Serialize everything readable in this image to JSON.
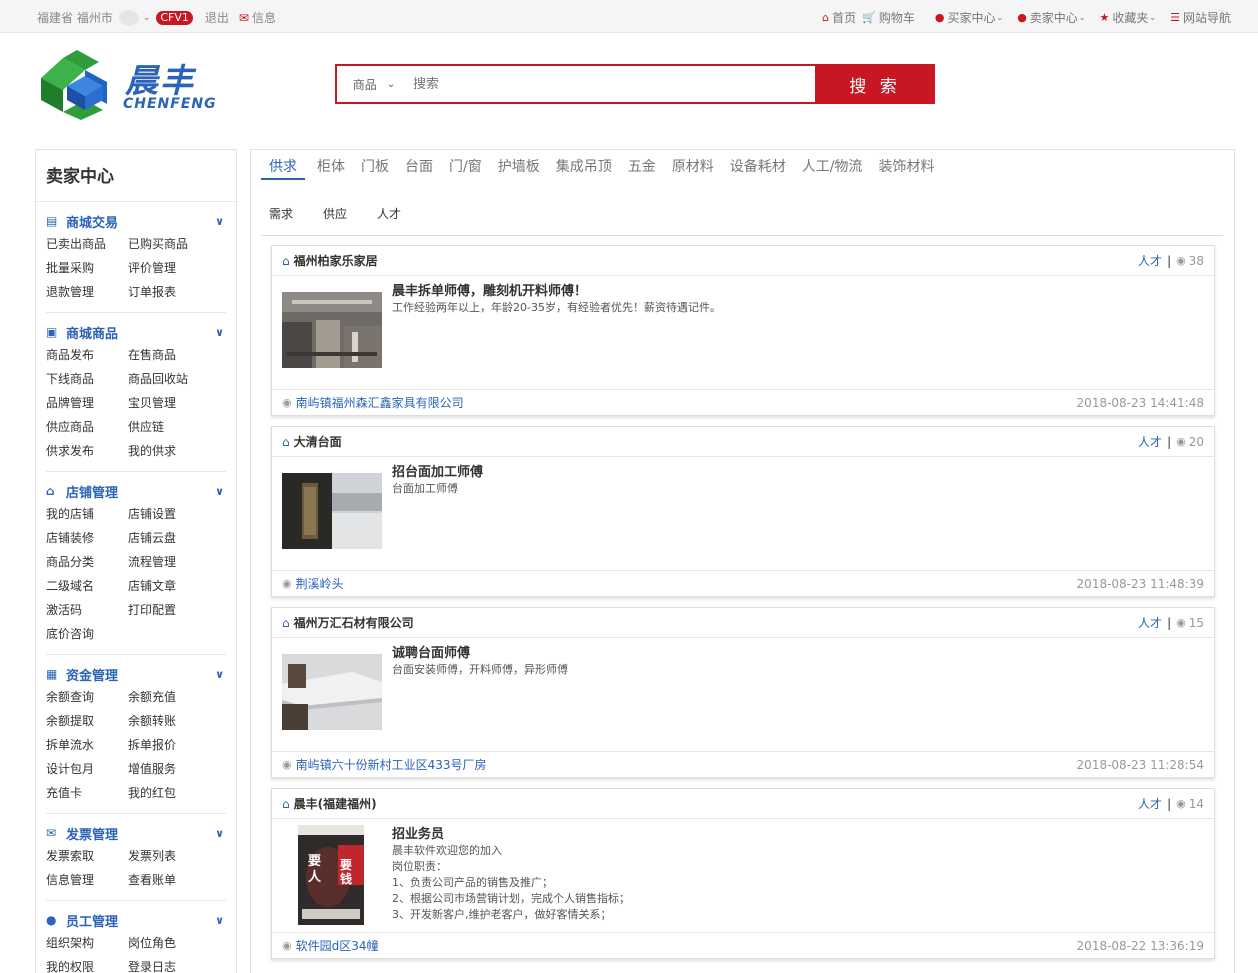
{
  "topbar": {
    "location": "福建省 福州市",
    "badge": "CFV1",
    "logout": "退出",
    "messages": "信息",
    "links": [
      {
        "icon": "home-icon",
        "label": "首页"
      },
      {
        "icon": "cart-icon",
        "label": "购物车"
      },
      {
        "icon": "user-icon",
        "label": "买家中心"
      },
      {
        "icon": "user-icon",
        "label": "卖家中心"
      },
      {
        "icon": "star-icon",
        "label": "收藏夹"
      },
      {
        "icon": "list-icon",
        "label": "网站导航"
      }
    ]
  },
  "logo": {
    "cn": "晨丰",
    "en": "CHENFENG"
  },
  "search": {
    "scope": "商品",
    "placeholder": "搜索",
    "button": "搜 索"
  },
  "sidebar": {
    "title": "卖家中心",
    "sections": [
      {
        "icon": "card-icon",
        "title": "商城交易",
        "items": [
          "已卖出商品",
          "已购买商品",
          "批量采购",
          "评价管理",
          "退款管理",
          "订单报表"
        ]
      },
      {
        "icon": "truck-icon",
        "title": "商城商品",
        "items": [
          "商品发布",
          "在售商品",
          "下线商品",
          "商品回收站",
          "品牌管理",
          "宝贝管理",
          "供应商品",
          "供应链",
          "供求发布",
          "我的供求"
        ]
      },
      {
        "icon": "home-icon",
        "title": "店铺管理",
        "items": [
          "我的店铺",
          "店铺设置",
          "店铺装修",
          "店铺云盘",
          "商品分类",
          "流程管理",
          "二级域名",
          "店铺文章",
          "激活码",
          "打印配置",
          "底价咨询"
        ]
      },
      {
        "icon": "money-icon",
        "title": "资金管理",
        "items": [
          "余额查询",
          "余额充值",
          "余额提取",
          "余额转账",
          "拆单流水",
          "拆单报价",
          "设计包月",
          "增值服务",
          "充值卡",
          "我的红包"
        ]
      },
      {
        "icon": "envelope-icon",
        "title": "发票管理",
        "items": [
          "发票索取",
          "发票列表",
          "信息管理",
          "查看账单"
        ]
      },
      {
        "icon": "users-icon",
        "title": "员工管理",
        "items": [
          "组织架构",
          "岗位角色",
          "我的权限",
          "登录日志"
        ]
      }
    ]
  },
  "categories": [
    "供求",
    "柜体",
    "门板",
    "台面",
    "门/窗",
    "护墙板",
    "集成吊顶",
    "五金",
    "原材料",
    "设备耗材",
    "人工/物流",
    "装饰材料"
  ],
  "active_category": "供求",
  "subtabs": [
    "需求",
    "供应",
    "人才"
  ],
  "posts": [
    {
      "shop": "福州柏家乐家居",
      "tag": "人才",
      "views": "38",
      "title": "晨丰拆单师傅，雕刻机开料师傅！",
      "desc": "工作经验两年以上，年龄20-35岁，有经验者优先！薪资待遇记件。",
      "address": "南屿镇福州森汇鑫家具有限公司",
      "time": "2018-08-23 14:41:48",
      "thumb": "factory"
    },
    {
      "shop": "大清台面",
      "tag": "人才",
      "views": "20",
      "title": "招台面加工师傅",
      "desc": "台面加工师傅",
      "address": "荆溪岭头",
      "time": "2018-08-23 11:48:39",
      "thumb": "edge"
    },
    {
      "shop": "福州万汇石材有限公司",
      "tag": "人才",
      "views": "15",
      "title": "诚聘台面师傅",
      "desc": "台面安装师傅，开料师傅，异形师傅",
      "address": "南屿镇六十份新村工业区433号厂房",
      "time": "2018-08-23 11:28:54",
      "thumb": "table"
    },
    {
      "shop": "晨丰(福建福州)",
      "tag": "人才",
      "views": "14",
      "title": "招业务员",
      "desc": "晨丰软件欢迎您的加入\n岗位职责：\n1、负责公司产品的销售及推广；\n2、根据公司市场营销计划，完成个人销售指标；\n3、开发新客户,维护老客户，做好客情关系；",
      "address": "软件园d区34幢",
      "time": "2018-08-22 13:36:19",
      "thumb": "poster",
      "poster_text": [
        "要",
        "人",
        "要",
        "钱"
      ]
    }
  ]
}
